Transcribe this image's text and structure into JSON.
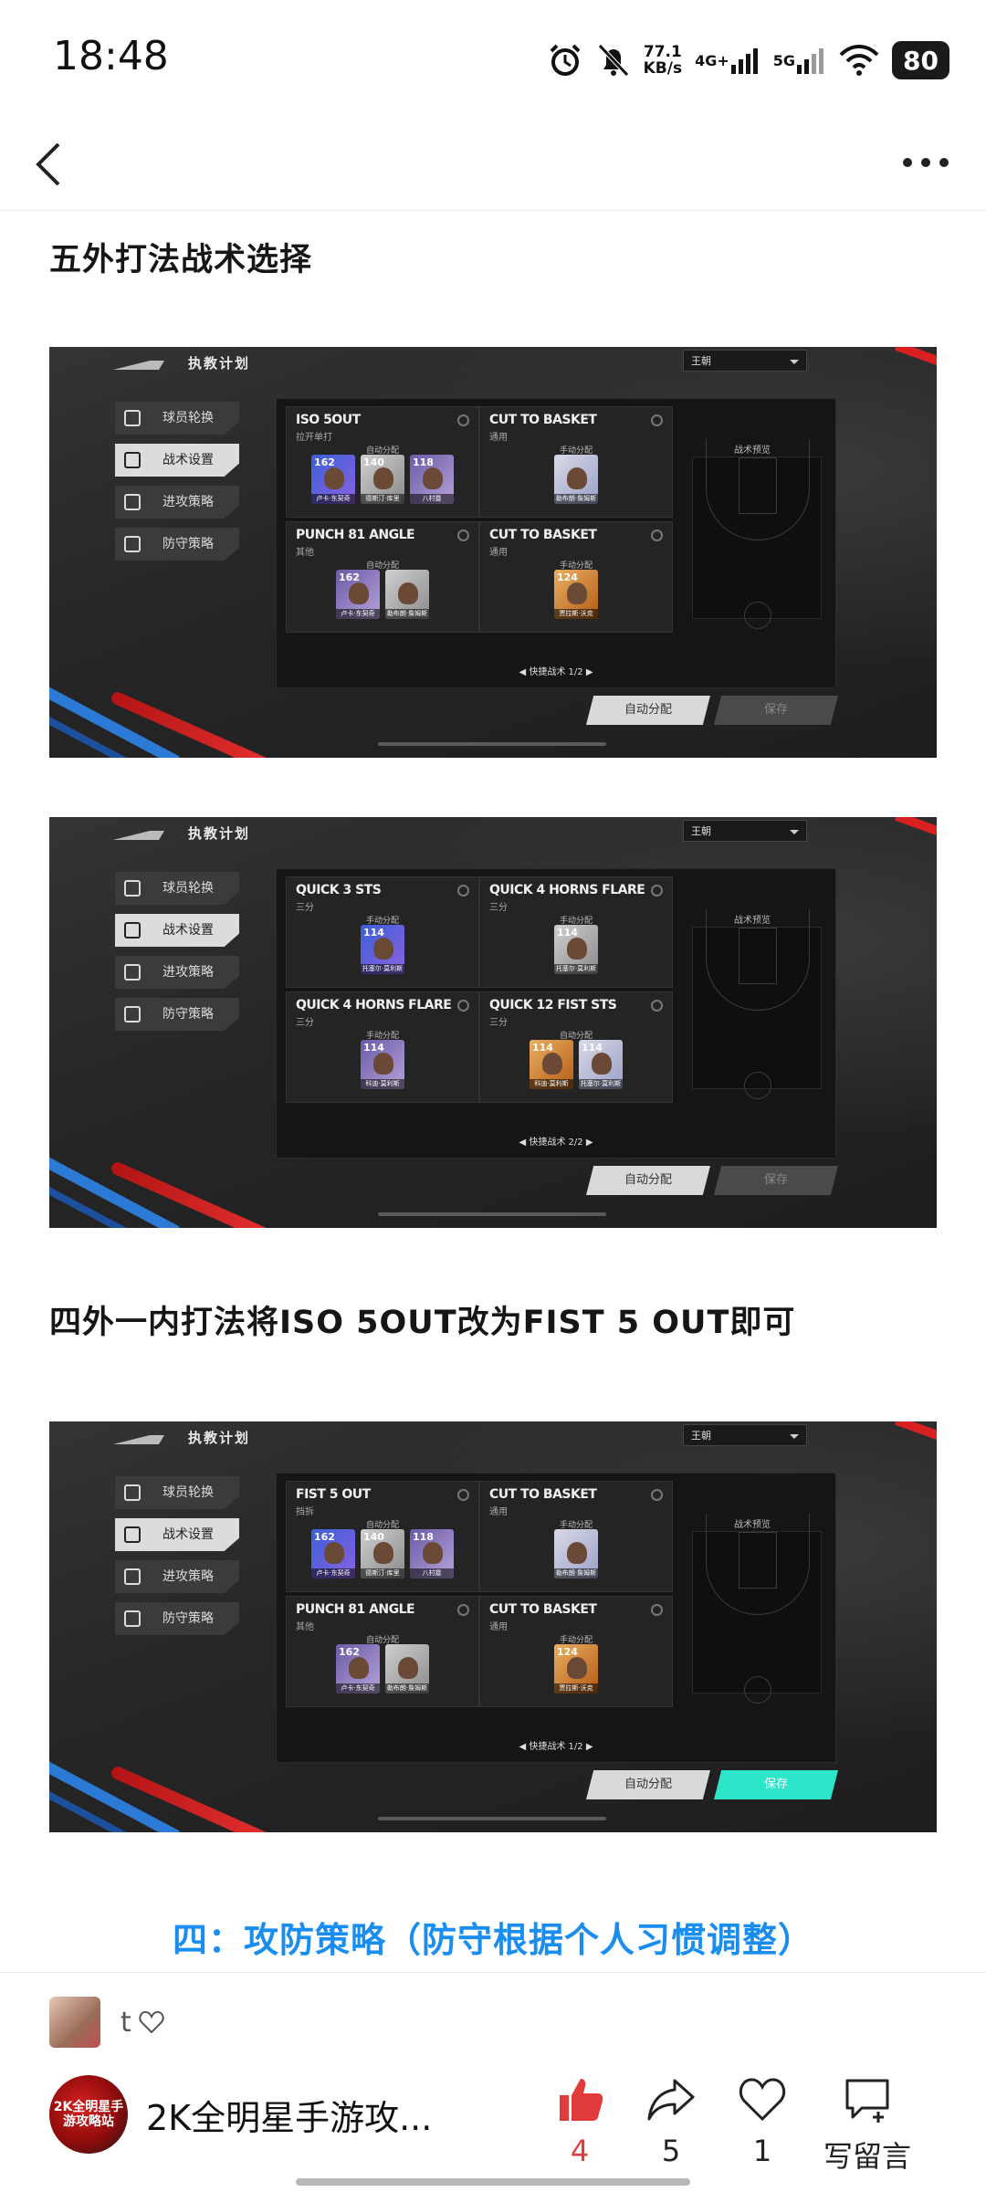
{
  "status_bar": {
    "time": "18:48",
    "net_speed_value": "77.1",
    "net_speed_unit": "KB/s",
    "signal1": "4G+",
    "signal2": "5G",
    "battery": "80"
  },
  "nav": {
    "back_icon": "chevron-left-icon",
    "more_icon": "more-dots-icon"
  },
  "article": {
    "heading1": "五外打法战术选择",
    "heading2": "四外一内打法将ISO 5OUT改为FIST 5 OUT即可",
    "section_heading": "四：攻防策略（防守根据个人习惯调整）"
  },
  "game_common": {
    "title": "执教计划",
    "dropdown": "王朝",
    "menu": [
      "球员轮换",
      "战术设置",
      "进攻策略",
      "防守策略"
    ],
    "court_label": "战术预览",
    "auto_button": "自动分配",
    "save_button": "保存"
  },
  "screenshots": [
    {
      "pager": "快捷战术 1/2",
      "cards": [
        {
          "name": "ISO 5OUT",
          "sub": "拉开单打",
          "tag": "自动分配",
          "players": [
            {
              "val": "162",
              "name": "卢卡·东契奇"
            },
            {
              "val": "140",
              "name": "德斯汀·库里"
            },
            {
              "val": "118",
              "name": "八村塁"
            }
          ]
        },
        {
          "name": "CUT TO BASKET",
          "sub": "通用",
          "tag": "手动分配",
          "players": [
            {
              "val": "",
              "name": "勒布朗·詹姆斯"
            }
          ]
        },
        {
          "name": "PUNCH 81 ANGLE",
          "sub": "其他",
          "tag": "自动分配",
          "players": [
            {
              "val": "162",
              "name": "卢卡·东契奇"
            },
            {
              "val": "",
              "name": "勒布朗·詹姆斯"
            }
          ]
        },
        {
          "name": "CUT TO BASKET",
          "sub": "通用",
          "tag": "手动分配",
          "players": [
            {
              "val": "124",
              "name": "贾拉斯·沃克"
            }
          ]
        }
      ]
    },
    {
      "pager": "快捷战术 2/2",
      "cards": [
        {
          "name": "QUICK 3 STS",
          "sub": "三分",
          "tag": "手动分配",
          "players": [
            {
              "val": "114",
              "name": "托塞尔·莫利斯"
            }
          ]
        },
        {
          "name": "QUICK 4 HORNS FLARE",
          "sub": "三分",
          "tag": "手动分配",
          "players": [
            {
              "val": "114",
              "name": "托塞尔·莫利斯"
            }
          ]
        },
        {
          "name": "QUICK 4 HORNS FLARE",
          "sub": "三分",
          "tag": "手动分配",
          "players": [
            {
              "val": "114",
              "name": "科迪·莫利斯"
            }
          ]
        },
        {
          "name": "QUICK 12 FIST STS",
          "sub": "三分",
          "tag": "自动分配",
          "players": [
            {
              "val": "114",
              "name": "科迪·莫利斯"
            },
            {
              "val": "114",
              "name": "托塞尔·莫利斯"
            }
          ]
        }
      ]
    },
    {
      "pager": "快捷战术 1/2",
      "cards": [
        {
          "name": "FIST 5 OUT",
          "sub": "挡拆",
          "tag": "自动分配",
          "players": [
            {
              "val": "162",
              "name": "卢卡·东契奇"
            },
            {
              "val": "140",
              "name": "德斯汀·库里"
            },
            {
              "val": "118",
              "name": "八村塁"
            }
          ]
        },
        {
          "name": "CUT TO BASKET",
          "sub": "通用",
          "tag": "手动分配",
          "players": [
            {
              "val": "",
              "name": "勒布朗·詹姆斯"
            }
          ]
        },
        {
          "name": "PUNCH 81 ANGLE",
          "sub": "其他",
          "tag": "自动分配",
          "players": [
            {
              "val": "162",
              "name": "卢卡·东契奇"
            },
            {
              "val": "",
              "name": "勒布朗·詹姆斯"
            }
          ]
        },
        {
          "name": "CUT TO BASKET",
          "sub": "通用",
          "tag": "手动分配",
          "players": [
            {
              "val": "124",
              "name": "贾拉斯·沃克"
            }
          ]
        }
      ]
    }
  ],
  "comment": {
    "user": "t",
    "icon": "heart-outline-icon"
  },
  "author": {
    "name": "2K全明星手游攻...",
    "logo_text": "2K全明星手游攻略站"
  },
  "actions": {
    "like_count": "4",
    "share_count": "5",
    "favorite_count": "1",
    "comment_label": "写留言"
  },
  "colors": {
    "accent_blue": "#1a8ef0",
    "like_red": "#e23b3b",
    "save_active": "#2de5c9"
  }
}
